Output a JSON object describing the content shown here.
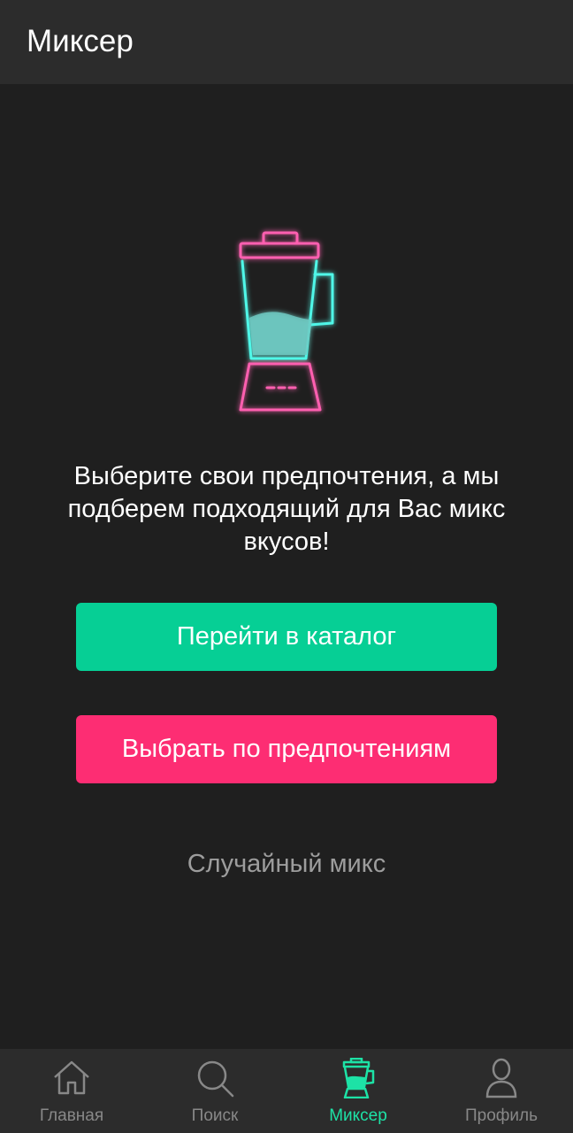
{
  "header": {
    "title": "Миксер"
  },
  "main": {
    "illustration_icon": "neon-blender-icon",
    "message": "Выберите свои предпочтения, а мы подберем подходящий для Вас микс вкусов!",
    "catalog_button": "Перейти в каталог",
    "preferences_button": "Выбрать по предпочтениям",
    "random_mix_link": "Случайный микс"
  },
  "bottom_nav": {
    "items": [
      {
        "label": "Главная",
        "icon": "home-icon",
        "active": false
      },
      {
        "label": "Поиск",
        "icon": "search-icon",
        "active": false
      },
      {
        "label": "Миксер",
        "icon": "blender-icon",
        "active": true
      },
      {
        "label": "Профиль",
        "icon": "profile-icon",
        "active": false
      }
    ]
  },
  "colors": {
    "background": "#1f1f1f",
    "bars": "#2c2c2c",
    "accent_green": "#06cf95",
    "accent_pink": "#fd2d73",
    "active_nav": "#1de2a6",
    "neon_cyan": "#4ff7e8",
    "neon_pink": "#ff5fb0"
  }
}
